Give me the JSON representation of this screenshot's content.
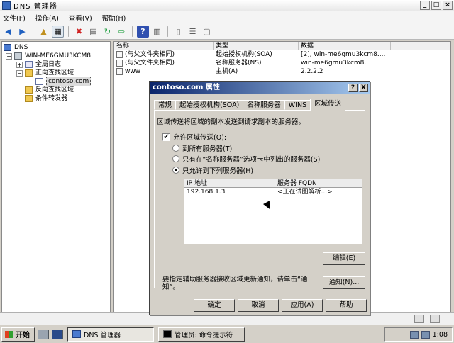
{
  "window": {
    "title": "DNS 管理器"
  },
  "menu": [
    "文件(F)",
    "操作(A)",
    "查看(V)",
    "帮助(H)"
  ],
  "toolbar": [
    "back-icon",
    "forward-icon",
    "up-icon",
    "show-hide-tree-icon",
    "delete-icon",
    "properties-icon",
    "refresh-icon",
    "export-icon",
    "help-icon",
    "grid-icon",
    "server-icon",
    "list-icon",
    "doc-icon"
  ],
  "tree": {
    "root": "DNS",
    "server": "WIN-ME6GMU3KCM8",
    "global_logs": "全局日志",
    "forward_zones": "正向查找区域",
    "zone": "contoso.com",
    "reverse_zones": "反向查找区域",
    "forwarders": "条件转发器"
  },
  "list": {
    "columns": [
      "名称",
      "类型",
      "数据"
    ],
    "rows": [
      {
        "name": "(与父文件夹相同)",
        "type": "起始授权机构(SOA)",
        "data": "[2], win-me6gmu3kcm8...."
      },
      {
        "name": "(与父文件夹相同)",
        "type": "名称服务器(NS)",
        "data": "win-me6gmu3kcm8."
      },
      {
        "name": "www",
        "type": "主机(A)",
        "data": "2.2.2.2"
      }
    ]
  },
  "dialog": {
    "title": "contoso.com 属性",
    "help_btn": "?",
    "close_btn": "X",
    "tabs": [
      "常规",
      "起始授权机构(SOA)",
      "名称服务器",
      "WINS",
      "区域传送"
    ],
    "description": "区域传送将区域的副本发送到请求副本的服务器。",
    "allow_transfer_label": "允许区域传送(O):",
    "allow_transfer_checked": true,
    "radio_options": [
      "到所有服务器(T)",
      "只有在“名称服务器”选项卡中列出的服务器(S)",
      "只允许到下列服务器(H)"
    ],
    "radio_selected_index": 2,
    "ip_table": {
      "columns": [
        "IP 地址",
        "服务器 FQDN"
      ],
      "rows": [
        {
          "ip": "192.168.1.3",
          "fqdn": "<正在试图解析...>"
        }
      ]
    },
    "edit_button": "编辑(E)",
    "note": "要指定辅助服务器接收区域更新通知，请单击“通知”。",
    "notify_button": "通知(N)...",
    "buttons": {
      "ok": "确定",
      "cancel": "取消",
      "apply": "应用(A)",
      "help": "帮助"
    }
  },
  "taskbar": {
    "start": "开始",
    "tasks": [
      "DNS 管理器",
      "管理员: 命令提示符"
    ],
    "clock": "1:08"
  }
}
